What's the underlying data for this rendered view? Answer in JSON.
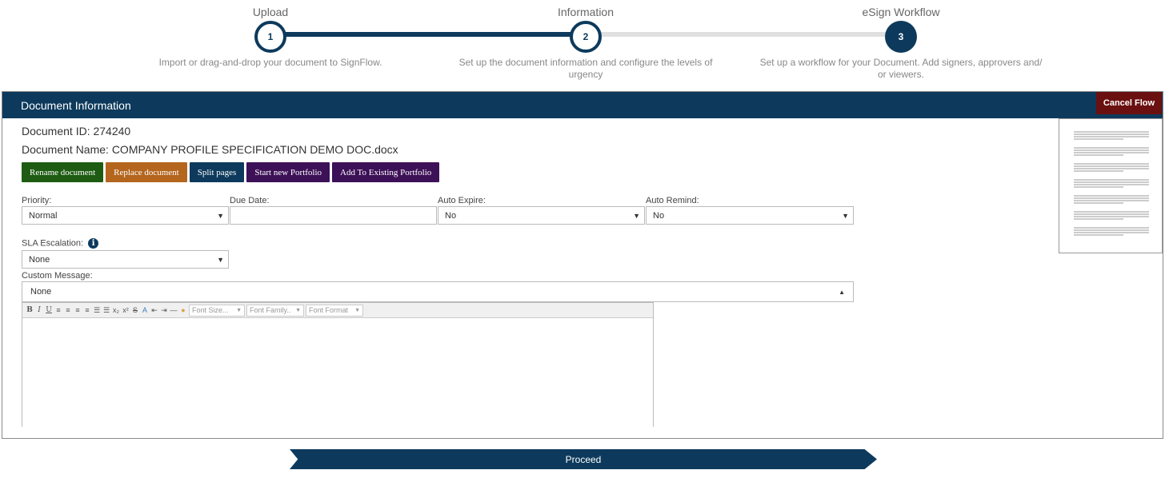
{
  "stepper": {
    "steps": [
      {
        "title": "Upload",
        "number": "1",
        "description": "Import or drag-and-drop your document to SignFlow."
      },
      {
        "title": "Information",
        "number": "2",
        "description": "Set up the document information and configure the levels of urgency"
      },
      {
        "title": "eSign Workflow",
        "number": "3",
        "description": "Set up a workflow for your Document. Add signers, approvers and/ or viewers."
      }
    ],
    "current_step": 2
  },
  "panel": {
    "title": "Document Information",
    "cancel_label": "Cancel Flow"
  },
  "document": {
    "id_label": "Document ID: 274240",
    "name_label": "Document Name: COMPANY PROFILE SPECIFICATION DEMO DOC.docx"
  },
  "actions": {
    "rename": "Rename document",
    "replace": "Replace document",
    "split": "Split pages",
    "start_portfolio": "Start new Portfolio",
    "add_portfolio": "Add To Existing Portfolio"
  },
  "form": {
    "priority": {
      "label": "Priority:",
      "value": "Normal"
    },
    "due_date": {
      "label": "Due Date:",
      "value": ""
    },
    "auto_expire": {
      "label": "Auto Expire:",
      "value": "No"
    },
    "auto_remind": {
      "label": "Auto Remind:",
      "value": "No"
    },
    "sla_escalation": {
      "label": "SLA Escalation:",
      "value": "None"
    },
    "custom_message": {
      "label": "Custom Message:",
      "value": "None"
    }
  },
  "editor_toolbar": {
    "icons": [
      "bold-icon",
      "italic-icon",
      "underline-icon",
      "align-left-icon",
      "align-center-icon",
      "align-right-icon",
      "align-justify-icon",
      "bullet-list-icon",
      "numbered-list-icon",
      "subscript-icon",
      "superscript-icon",
      "strikethrough-icon",
      "format-clear-icon",
      "outdent-icon",
      "indent-icon",
      "horizontal-rule-icon",
      "paint-icon"
    ],
    "font_size": "Font Size...",
    "font_family": "Font Family..",
    "font_format": "Font Format"
  },
  "proceed_label": "Proceed",
  "colors": {
    "primary": "#0d3a5c",
    "cancel": "#6b1010",
    "rename": "#1e5c13",
    "replace": "#b4651e",
    "portfolio": "#3d1157",
    "inactive_line": "#e0e0e0"
  }
}
